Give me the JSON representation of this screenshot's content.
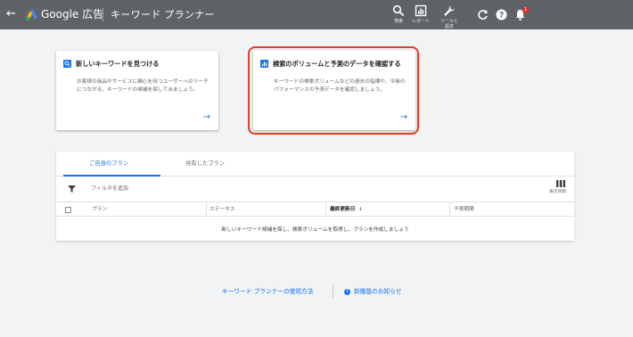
{
  "topbar": {
    "brand": "Google 広告",
    "page_title": "キーワード プランナー",
    "items": [
      {
        "label": "検索",
        "icon": "search-icon"
      },
      {
        "label": "レポート",
        "icon": "reports-icon"
      },
      {
        "label": "ツールと設定",
        "icon": "wrench-icon"
      }
    ],
    "notification_count": "1"
  },
  "cards": [
    {
      "title": "新しいキーワードを見つける",
      "description": "お客様の商品やサービスに関心を持つユーザーへのリーチにつながる、キーワードの候補を探してみましょう。",
      "icon": "search-icon"
    },
    {
      "title": "検索のボリュームと予測のデータを確認する",
      "description": "キーワードの検索ボリュームなどの過去の指標や、今後のパフォーマンスの予測データを確認しましょう。",
      "icon": "bar-chart-icon"
    }
  ],
  "plans": {
    "tabs": [
      "ご自身のプラン",
      "共有したプラン"
    ],
    "active_tab": 0,
    "filter_label": "フィルタを追加",
    "columns_label": "表示項目",
    "columns": [
      "プラン",
      "ステータス",
      "最終更新日",
      "予測期間"
    ],
    "sorted_column": "最終更新日",
    "empty_message": "新しいキーワード候補を探し、検索ボリュームを取得し、プランを作成しましょう"
  },
  "footer": {
    "link_usage": "キーワード プランナーの使用方法",
    "link_news": "新機能のお知らせ"
  },
  "colors": {
    "topbar": "#5f6368",
    "accent": "#1a73e8",
    "highlight": "#e53d21",
    "background": "#f1f3f4"
  }
}
